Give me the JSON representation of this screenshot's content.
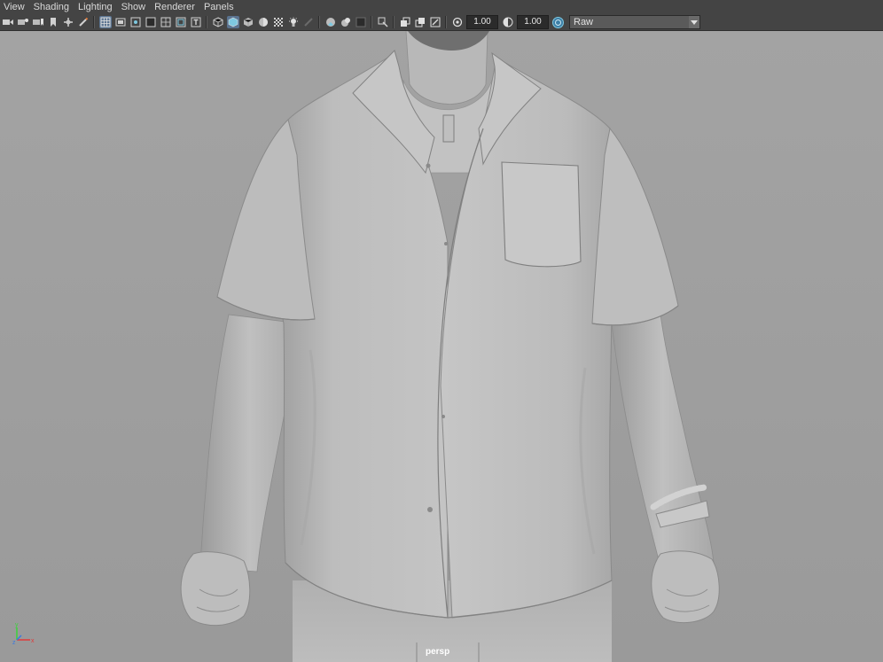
{
  "menubar": {
    "items": [
      "View",
      "Shading",
      "Lighting",
      "Show",
      "Renderer",
      "Panels"
    ]
  },
  "toolbar": {
    "icons": [
      "camera-icon",
      "camera-attributes-icon",
      "bookmark-icon",
      "image-plane-icon",
      "2d-pan-zoom-icon",
      "grease-pencil-icon",
      "grid-icon",
      "film-gate-icon",
      "resolution-gate-icon",
      "gate-mask-icon",
      "field-chart-icon",
      "safe-action-icon",
      "safe-title-icon",
      "wireframe-icon",
      "smooth-shade-icon",
      "default-material-icon",
      "textured-icon",
      "use-all-lights-icon",
      "shadows-icon",
      "screen-space-ao-icon",
      "motion-blur-icon",
      "anti-aliasing-icon",
      "depth-of-field-icon",
      "isolate-select-icon",
      "xray-icon",
      "xray-joints-icon",
      "xray-active-icon",
      "exposure-icon",
      "gamma-icon",
      "color-management-icon"
    ],
    "exposure_value": "1.00",
    "gamma_value": "1.00",
    "view_transform": "Raw"
  },
  "viewport": {
    "camera_label": "persp",
    "background_color": "#a0a0a0",
    "model_base_color": "#b4b4b4"
  },
  "colors": {
    "ui_panel": "#444444",
    "active_icon": "#5a7390",
    "axis_x": "#e03a3a",
    "axis_y": "#3ad23a",
    "axis_z": "#3a7ae0"
  }
}
